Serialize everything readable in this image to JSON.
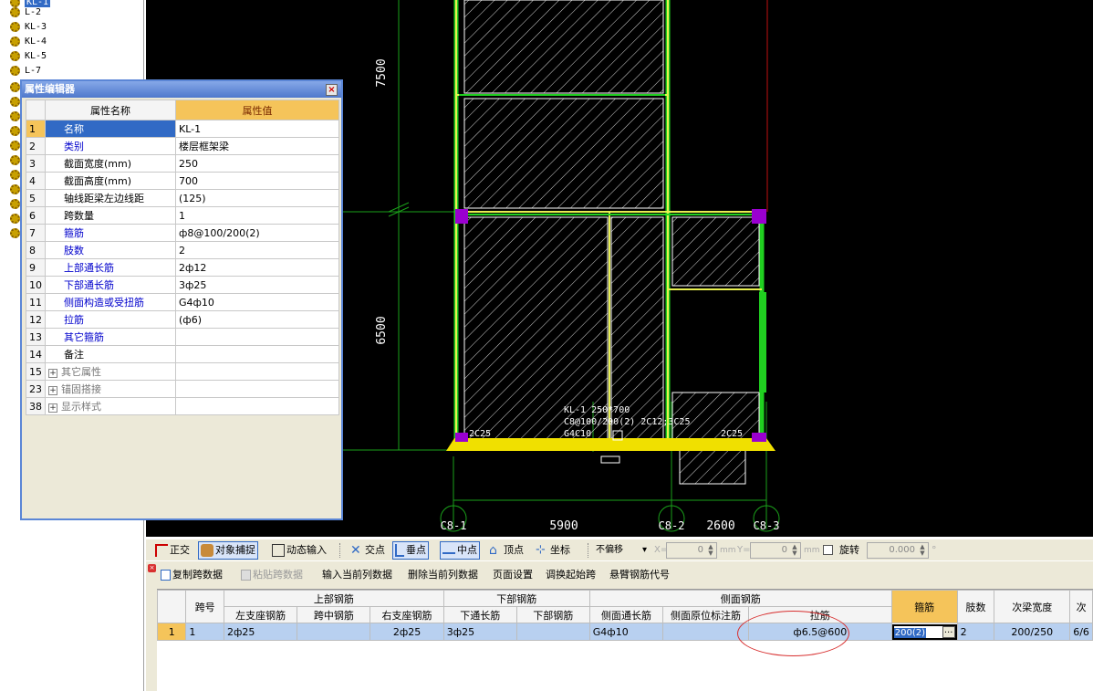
{
  "tree": {
    "items": [
      {
        "label": "KL-1",
        "selected": true
      },
      {
        "label": "L-2"
      },
      {
        "label": "KL-3"
      },
      {
        "label": "KL-4"
      },
      {
        "label": "KL-5"
      },
      {
        "label": "L-7"
      }
    ]
  },
  "cad": {
    "dims": {
      "top_left": "7500",
      "mid_left": "6500",
      "span1": "5900",
      "span2": "2600"
    },
    "axes": [
      "C8-1",
      "C8-2",
      "C8-3"
    ],
    "rebar_labels": {
      "left": "2C25",
      "right": "2C25"
    },
    "annotation": {
      "line1": "KL-1 250*700",
      "line2": "C8@100/200(2) 2C12;3C25",
      "line3": "G4C10"
    }
  },
  "property_editor": {
    "title": "属性编辑器",
    "col_name": "属性名称",
    "col_value": "属性值",
    "rows": [
      {
        "num": "1",
        "name": "名称",
        "value": "KL-1"
      },
      {
        "num": "2",
        "name": "类别",
        "value": "楼层框架梁"
      },
      {
        "num": "3",
        "name": "截面宽度(mm)",
        "value": "250"
      },
      {
        "num": "4",
        "name": "截面高度(mm)",
        "value": "700"
      },
      {
        "num": "5",
        "name": "轴线距梁左边线距",
        "value": "(125)"
      },
      {
        "num": "6",
        "name": "跨数量",
        "value": "1"
      },
      {
        "num": "7",
        "name": "箍筋",
        "value": "ф8@100/200(2)"
      },
      {
        "num": "8",
        "name": "肢数",
        "value": "2"
      },
      {
        "num": "9",
        "name": "上部通长筋",
        "value": "2ф12"
      },
      {
        "num": "10",
        "name": "下部通长筋",
        "value": "3ф25"
      },
      {
        "num": "11",
        "name": "侧面构造或受扭筋",
        "value": "G4ф10"
      },
      {
        "num": "12",
        "name": "拉筋",
        "value": "(ф6)"
      },
      {
        "num": "13",
        "name": "其它箍筋",
        "value": ""
      },
      {
        "num": "14",
        "name": "备注",
        "value": ""
      },
      {
        "num": "15",
        "name": "其它属性",
        "value": ""
      },
      {
        "num": "23",
        "name": "锚固搭接",
        "value": ""
      },
      {
        "num": "38",
        "name": "显示样式",
        "value": ""
      }
    ]
  },
  "snapbar": {
    "ortho": "正交",
    "osnap": "对象捕捉",
    "dyn_input": "动态输入",
    "intersection": "交点",
    "perpendicular": "垂点",
    "midpoint": "中点",
    "vertex": "顶点",
    "coordinate": "坐标",
    "offset_mode": "不偏移",
    "x_label": "X=",
    "x_value": "0",
    "x_unit": "mm",
    "y_label": "Y=",
    "y_value": "0",
    "y_unit": "mm",
    "rotate_label": "旋转",
    "rotate_value": "0.000",
    "rotate_unit": "°"
  },
  "actions": {
    "copy_span": "复制跨数据",
    "paste_span": "粘贴跨数据",
    "input_col": "输入当前列数据",
    "delete_col": "删除当前列数据",
    "page_setup": "页面设置",
    "swap_start": "调换起始跨",
    "cantilever": "悬臂钢筋代号"
  },
  "grid": {
    "headers": {
      "span_no": "跨号",
      "top_rebar": "上部钢筋",
      "bottom_rebar": "下部钢筋",
      "side_rebar": "侧面钢筋",
      "stirrup": "箍筋",
      "legs": "肢数",
      "sec_beam_width": "次梁宽度",
      "next_col": "次"
    },
    "subheaders": {
      "left_support": "左支座钢筋",
      "mid_span": "跨中钢筋",
      "right_support": "右支座钢筋",
      "bottom_through": "下通长筋",
      "bottom_rebar": "下部钢筋",
      "side_through": "侧面通长筋",
      "side_original": "侧面原位标注筋",
      "tie": "拉筋"
    },
    "row": {
      "row_num": "1",
      "span": "1",
      "left_support": "2ф25",
      "mid_span": "",
      "right_support": "2ф25",
      "bottom_through": "3ф25",
      "bottom_rebar": "",
      "side_through": "G4ф10",
      "side_original": "",
      "tie": "ф6.5@600",
      "stirrup": "200(2)",
      "legs": "2",
      "sec_beam_width": "200/250",
      "next": "6/6"
    }
  }
}
